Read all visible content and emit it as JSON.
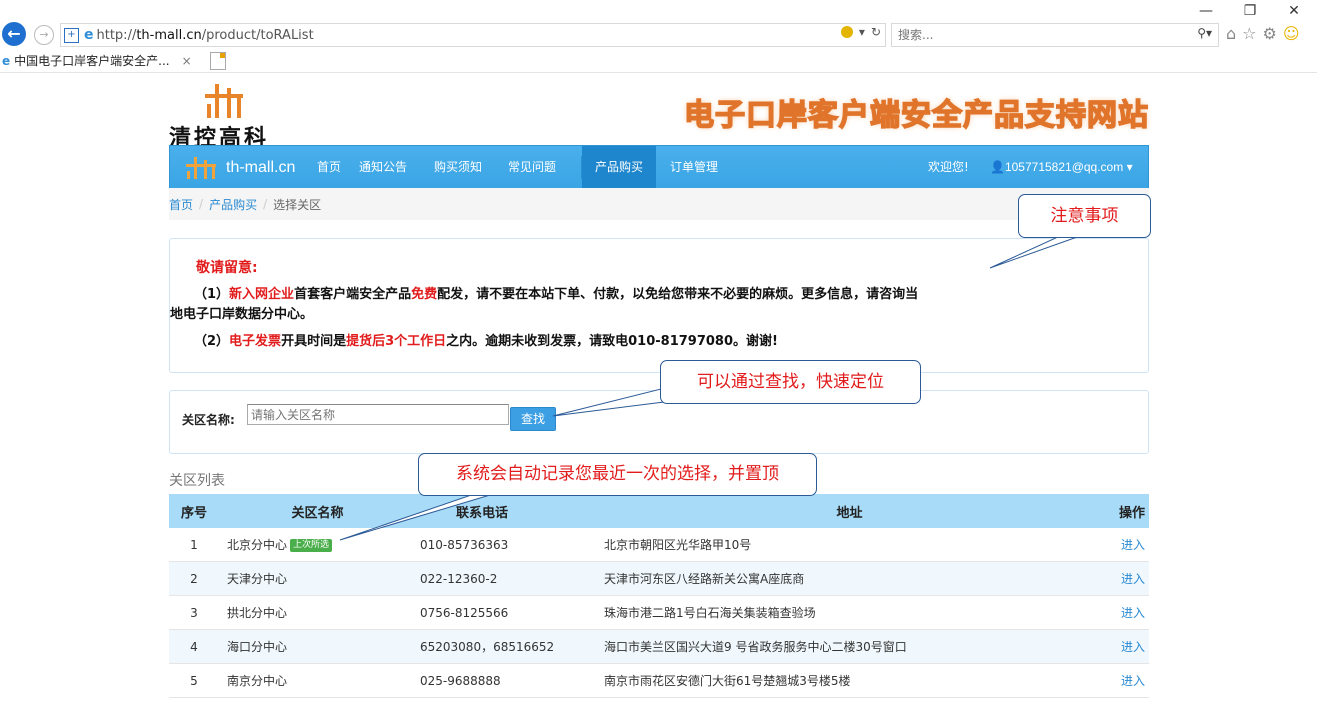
{
  "browser": {
    "url_prefix": "http://",
    "url_host": "th-mall.cn",
    "url_path": "/product/toRAList",
    "search_placeholder": "搜索...",
    "tab_title": "中国电子口岸客户端安全产...",
    "tab_close": "×",
    "win_minimize": "—",
    "win_restore": "❐",
    "win_close": "✕",
    "refresh": "↻",
    "dropdown": "▾",
    "search_icon": "⚲▾",
    "toolbar_icons": [
      "home-icon",
      "favorites-star-icon",
      "tools-gear-icon",
      "smiley-feedback-icon"
    ]
  },
  "header": {
    "logo_text": "清控高科",
    "banner_text": "电子口岸客户端安全产品支持网站"
  },
  "nav": {
    "brand": "th-mall.cn",
    "items": [
      "首页",
      "通知公告",
      "购买须知",
      "常见问题"
    ],
    "active": "产品购买",
    "order": "订单管理",
    "welcome": "欢迎您!",
    "user": "1057715821@qq.com"
  },
  "breadcrumb": {
    "home": "首页",
    "products": "产品购买",
    "current": "选择关区",
    "sep": "/"
  },
  "notice": {
    "title": "敬请留意:",
    "line1_a": "（1）",
    "line1_b": "新入网企业",
    "line1_c": "首套客户端安全产品",
    "line1_d": "免费",
    "line1_e": "配发，请不要在本站下单、付款，以免给您带来不必要的麻烦。更多信息，请咨询当",
    "line1_f": "地电子口岸数据分中心。",
    "line2_a": "（2）",
    "line2_b": "电子发票",
    "line2_c": "开具时间是",
    "line2_d": "提货后3个工作日",
    "line2_e": "之内。逾期未收到发票，请致电010-81797080。谢谢!"
  },
  "search": {
    "label": "关区名称:",
    "placeholder": "请输入关区名称",
    "button": "查找"
  },
  "list": {
    "title": "关区列表",
    "headers": [
      "序号",
      "关区名称",
      "联系电话",
      "地址",
      "操作"
    ],
    "badge": "上次所选",
    "rows": [
      {
        "no": "1",
        "name": "北京分中心",
        "phone": "010-85736363",
        "addr": "北京市朝阳区光华路甲10号",
        "op": "进入"
      },
      {
        "no": "2",
        "name": "天津分中心",
        "phone": "022-12360-2",
        "addr": "天津市河东区八经路新关公寓A座底商",
        "op": "进入"
      },
      {
        "no": "3",
        "name": "拱北分中心",
        "phone": "0756-8125566",
        "addr": "珠海市港二路1号白石海关集装箱查验场",
        "op": "进入"
      },
      {
        "no": "4",
        "name": "海口分中心",
        "phone": "65203080，68516652",
        "addr": "海口市美兰区国兴大道9 号省政务服务中心二楼30号窗口",
        "op": "进入"
      },
      {
        "no": "5",
        "name": "南京分中心",
        "phone": "025-9688888",
        "addr": "南京市雨花区安德门大街61号楚翘城3号楼5楼",
        "op": "进入"
      }
    ]
  },
  "callouts": {
    "notice": "注意事项",
    "search": "可以通过查找，快速定位",
    "pinned": "系统会自动记录您最近一次的选择，并置顶"
  },
  "colors": {
    "nav": "#3aa4e4",
    "red": "#e21c1c",
    "table_head": "#a8dbf7",
    "link": "#2a8ad2"
  }
}
